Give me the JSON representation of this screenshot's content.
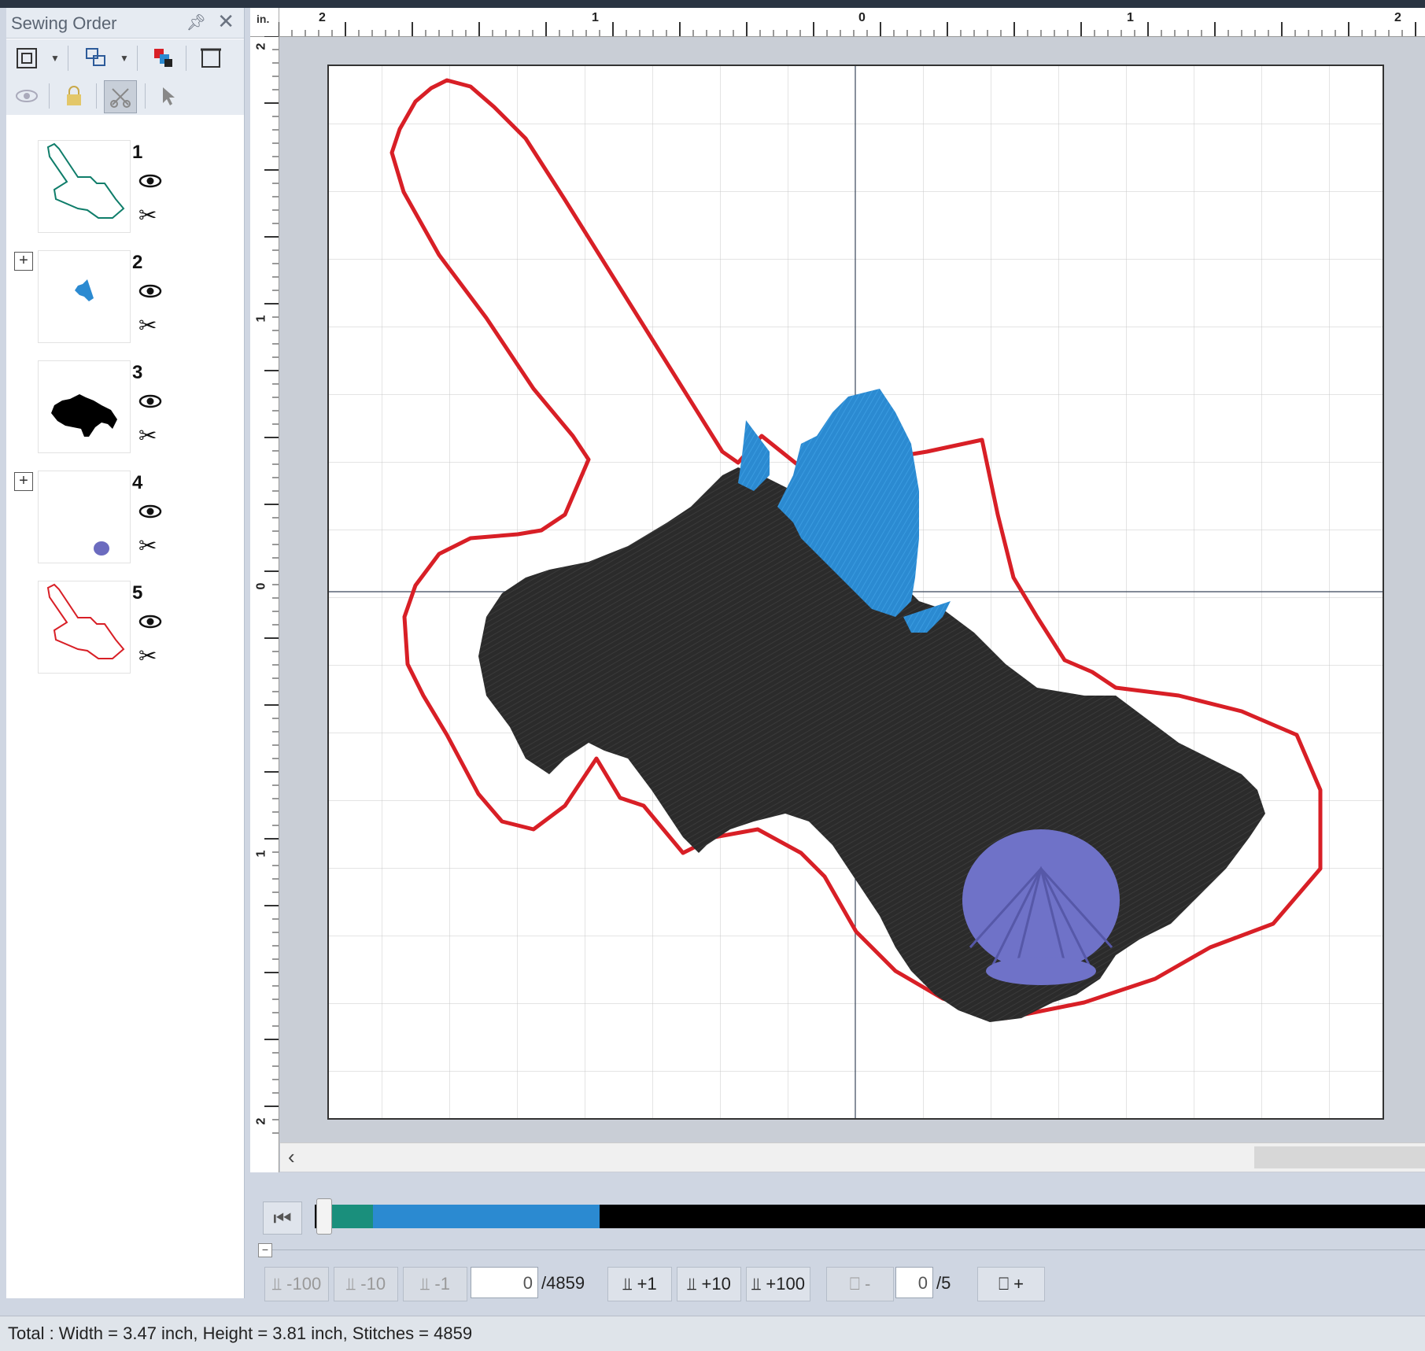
{
  "panel": {
    "title": "Sewing Order",
    "pin_icon": "pin-icon",
    "close_icon": "close-icon"
  },
  "layers": [
    {
      "number": "1",
      "color": "#0f7d6a",
      "expandable": false
    },
    {
      "number": "2",
      "color": "#2b8ad1",
      "expandable": true
    },
    {
      "number": "3",
      "color": "#000000",
      "expandable": false
    },
    {
      "number": "4",
      "color": "#6b6bbf",
      "expandable": true
    },
    {
      "number": "5",
      "color": "#d81f26",
      "expandable": false
    }
  ],
  "ruler": {
    "units": "in.",
    "h_labels": [
      "2",
      "1",
      "0",
      "1",
      "2"
    ],
    "v_labels": [
      "2",
      "1",
      "0",
      "1",
      "2"
    ]
  },
  "design_colors": {
    "outline": "#d81f26",
    "body": "#2b2b2b",
    "fins": "#2b8ad1",
    "shell": "#6f72c8"
  },
  "stitch_nav": {
    "minus100": "-100",
    "minus10": "-10",
    "minus1": "-1",
    "current_stitch": "0",
    "total_stitches": "/4859",
    "plus1": "+1",
    "plus10": "+10",
    "plus100": "+100",
    "color_minus": "-",
    "current_color": "0",
    "total_colors": "/5",
    "color_plus": "+"
  },
  "progress": {
    "segments": [
      {
        "color": "#1a8f7c"
      },
      {
        "color": "#2b8ad1"
      },
      {
        "color": "#000000"
      }
    ]
  },
  "status": {
    "text": "Total : Width = 3.47 inch, Height = 3.81 inch, Stitches = 4859"
  }
}
